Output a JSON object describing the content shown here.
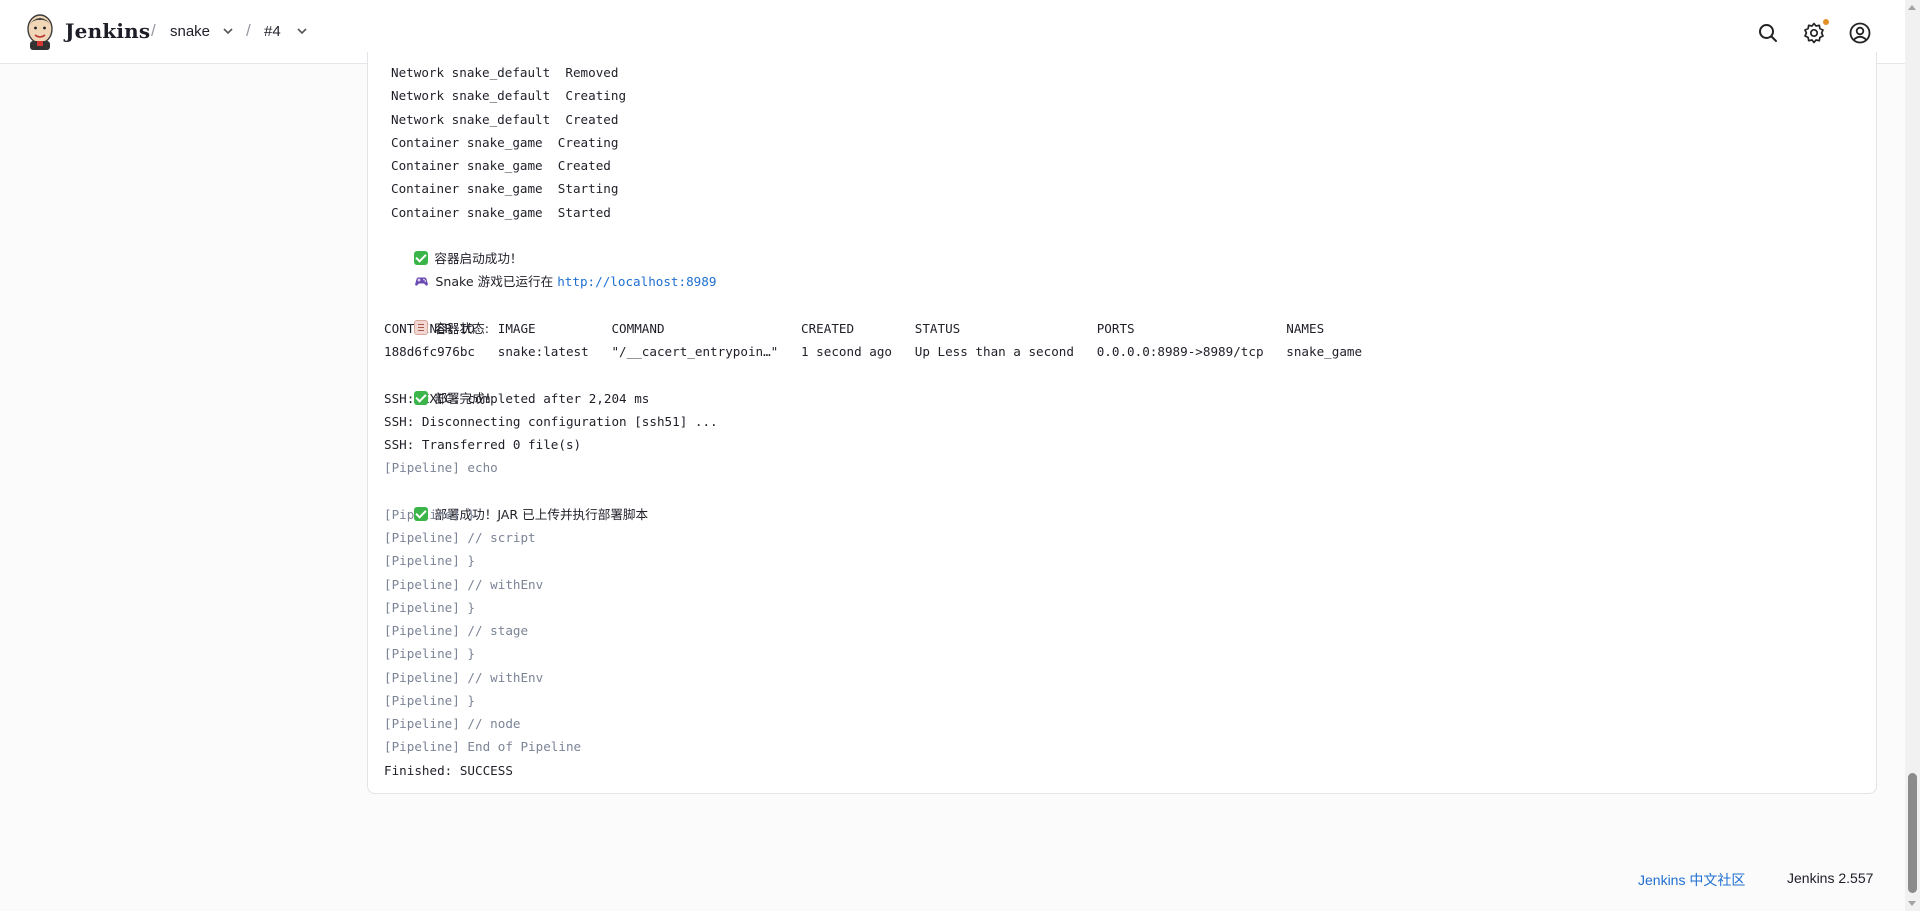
{
  "header": {
    "brand": "Jenkins",
    "breadcrumb": [
      {
        "label": "snake"
      },
      {
        "label": "#4"
      }
    ],
    "separator": "/",
    "icons": [
      "search-icon",
      "gear-icon",
      "user-icon"
    ],
    "notification_color": "#e58f27"
  },
  "console": {
    "lines": [
      {
        "text": "Network snake_default  Removed",
        "kind": "plain",
        "indent": true
      },
      {
        "text": "Network snake_default  Creating",
        "kind": "plain",
        "indent": true
      },
      {
        "text": "Network snake_default  Created",
        "kind": "plain",
        "indent": true
      },
      {
        "text": "Container snake_game  Creating",
        "kind": "plain",
        "indent": true
      },
      {
        "text": "Container snake_game  Created",
        "kind": "plain",
        "indent": true
      },
      {
        "text": "Container snake_game  Starting",
        "kind": "plain",
        "indent": true
      },
      {
        "text": "Container snake_game  Started",
        "kind": "plain",
        "indent": true
      },
      {
        "text": "容器启动成功！",
        "kind": "plain",
        "emoji": "check-icon"
      },
      {
        "text": "Snake 游戏已运行在 ",
        "kind": "plain",
        "emoji": "game-controller-icon",
        "link": "http://localhost:8989"
      },
      {
        "text": "",
        "kind": "blank"
      },
      {
        "text": "容器状态:",
        "kind": "plain",
        "emoji": "clipboard-icon"
      },
      {
        "text": "CONTAINER ID   IMAGE          COMMAND                  CREATED        STATUS                  PORTS                    NAMES",
        "kind": "plain"
      },
      {
        "text": "188d6fc976bc   snake:latest   \"/__cacert_entrypoin…\"   1 second ago   Up Less than a second   0.0.0.0:8989->8989/tcp   snake_game",
        "kind": "plain"
      },
      {
        "text": "部署完成！",
        "kind": "plain",
        "emoji": "check-icon"
      },
      {
        "text": "SSH: EXEC: completed after 2,204 ms",
        "kind": "plain"
      },
      {
        "text": "SSH: Disconnecting configuration [ssh51] ...",
        "kind": "plain"
      },
      {
        "text": "SSH: Transferred 0 file(s)",
        "kind": "plain"
      },
      {
        "text": "[Pipeline] echo",
        "kind": "pipeline"
      },
      {
        "text": "部署成功！JAR 已上传并执行部署脚本",
        "kind": "plain",
        "emoji": "check-icon"
      },
      {
        "text": "[Pipeline] }",
        "kind": "pipeline"
      },
      {
        "text": "[Pipeline] // script",
        "kind": "pipeline"
      },
      {
        "text": "[Pipeline] }",
        "kind": "pipeline"
      },
      {
        "text": "[Pipeline] // withEnv",
        "kind": "pipeline"
      },
      {
        "text": "[Pipeline] }",
        "kind": "pipeline"
      },
      {
        "text": "[Pipeline] // stage",
        "kind": "pipeline"
      },
      {
        "text": "[Pipeline] }",
        "kind": "pipeline"
      },
      {
        "text": "[Pipeline] // withEnv",
        "kind": "pipeline"
      },
      {
        "text": "[Pipeline] }",
        "kind": "pipeline"
      },
      {
        "text": "[Pipeline] // node",
        "kind": "pipeline"
      },
      {
        "text": "[Pipeline] End of Pipeline",
        "kind": "pipeline"
      },
      {
        "text": "Finished: SUCCESS",
        "kind": "plain"
      }
    ],
    "pipeline_color": "#7b8496",
    "link_color": "#1f6fd0"
  },
  "footer": {
    "community_link": "Jenkins 中文社区",
    "version": "Jenkins 2.557"
  }
}
